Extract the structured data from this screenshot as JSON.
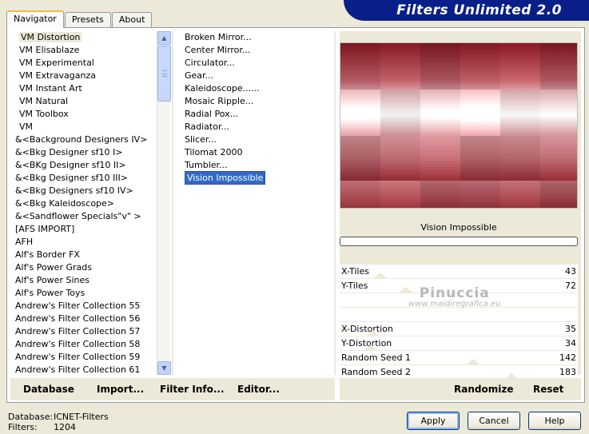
{
  "tabs": [
    {
      "label": "Navigator",
      "active": true
    },
    {
      "label": "Presets",
      "active": false
    },
    {
      "label": "About",
      "active": false
    }
  ],
  "app_title": "Filters Unlimited 2.0",
  "categories": [
    {
      "label": "VM Distortion",
      "selected": true,
      "indent": true
    },
    {
      "label": "VM Elisablaze",
      "indent": true
    },
    {
      "label": "VM Experimental",
      "indent": true
    },
    {
      "label": "VM Extravaganza",
      "indent": true
    },
    {
      "label": "VM Instant Art",
      "indent": true
    },
    {
      "label": "VM Natural",
      "indent": true
    },
    {
      "label": "VM Toolbox",
      "indent": true
    },
    {
      "label": "VM",
      "indent": true
    },
    {
      "label": "&<Background Designers IV>"
    },
    {
      "label": "&<Bkg Designer sf10 I>"
    },
    {
      "label": "&<BKg Designer sf10 II>"
    },
    {
      "label": "&<Bkg Designer sf10 III>"
    },
    {
      "label": "&<Bkg Designers sf10 IV>"
    },
    {
      "label": "&<Bkg Kaleidoscope>"
    },
    {
      "label": "&<Sandflower Specials\"v\" >"
    },
    {
      "label": "[AFS IMPORT]"
    },
    {
      "label": "AFH"
    },
    {
      "label": "Alf's Border FX"
    },
    {
      "label": "Alf's Power Grads"
    },
    {
      "label": "Alf's Power Sines"
    },
    {
      "label": "Alf's Power Toys"
    },
    {
      "label": "Andrew's Filter Collection 55"
    },
    {
      "label": "Andrew's Filter Collection 56"
    },
    {
      "label": "Andrew's Filter Collection 57"
    },
    {
      "label": "Andrew's Filter Collection 58"
    },
    {
      "label": "Andrew's Filter Collection 59"
    },
    {
      "label": "Andrew's Filter Collection 61"
    }
  ],
  "filters": [
    {
      "label": "Broken Mirror..."
    },
    {
      "label": "Center Mirror..."
    },
    {
      "label": "Circulator..."
    },
    {
      "label": "Gear..."
    },
    {
      "label": "Kaleidoscope......"
    },
    {
      "label": "Mosaic Ripple..."
    },
    {
      "label": "Radial Pox..."
    },
    {
      "label": "Radiator..."
    },
    {
      "label": "Slicer..."
    },
    {
      "label": "Tilomat 2000"
    },
    {
      "label": "Tumbler..."
    },
    {
      "label": "Vision Impossible",
      "selected": true
    }
  ],
  "selected_filter": "Vision Impossible",
  "params": [
    {
      "label": "X-Tiles",
      "value": "43",
      "slider": 0.17
    },
    {
      "label": "Y-Tiles",
      "value": "72",
      "slider": 0.28
    },
    {
      "label": "",
      "value": ""
    },
    {
      "label": "",
      "value": ""
    },
    {
      "label": "X-Distortion",
      "value": "35",
      "slider": 0.14
    },
    {
      "label": "Y-Distortion",
      "value": "34",
      "slider": 0.13
    },
    {
      "label": "Random Seed 1",
      "value": "142",
      "slider": 0.56
    },
    {
      "label": "Random Seed 2",
      "value": "183",
      "slider": 0.72
    }
  ],
  "watermark": {
    "line1": "Pinuccia",
    "line2": "www.maidiregrafica.eu"
  },
  "bottom_left": {
    "database": "Database",
    "import": "Import...",
    "filter_info": "Filter Info...",
    "editor": "Editor..."
  },
  "bottom_right": {
    "randomize": "Randomize",
    "reset": "Reset"
  },
  "status": {
    "db_label": "Database:",
    "db_value": "ICNET-Filters",
    "filters_label": "Filters:",
    "filters_value": "1204"
  },
  "buttons": {
    "apply": "Apply",
    "cancel": "Cancel",
    "help": "Help"
  },
  "colors": {
    "banner": "#0a1e8a",
    "selection": "#316ac5",
    "preview_dark": "#8b1a22"
  }
}
